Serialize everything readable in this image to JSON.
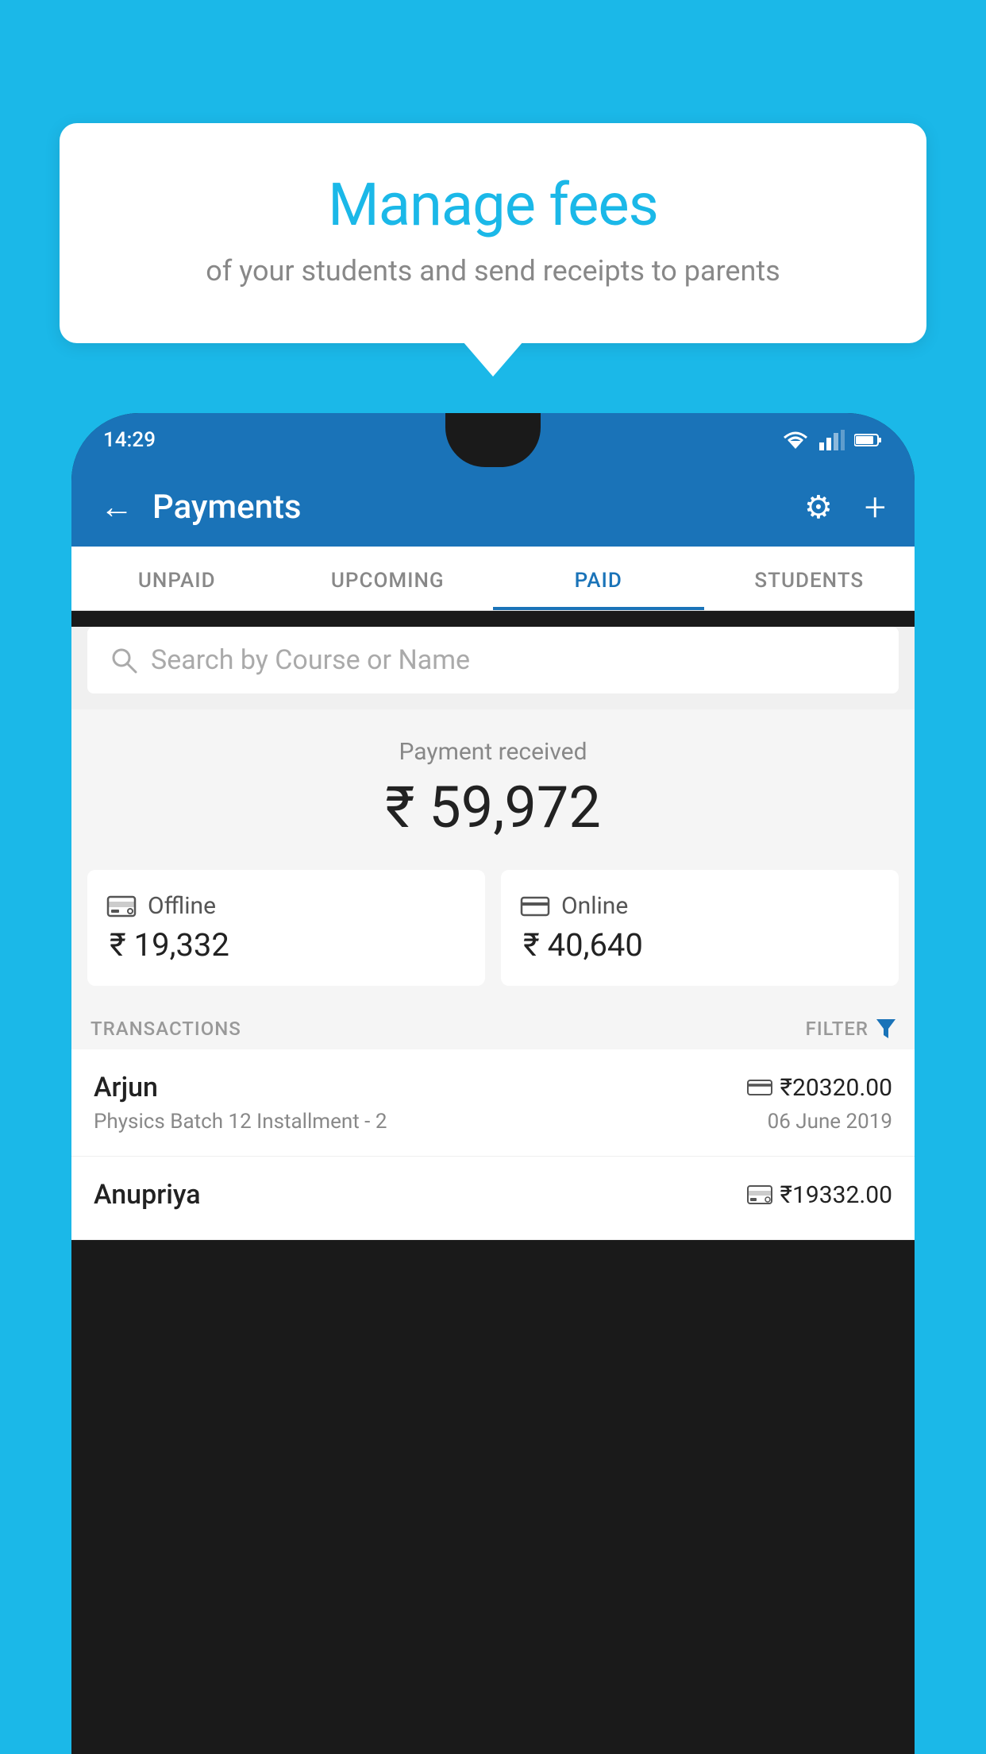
{
  "background_color": "#1BB8E8",
  "bubble": {
    "title": "Manage fees",
    "subtitle": "of your students and send receipts to parents"
  },
  "status_bar": {
    "time": "14:29",
    "signal_icon": "signal",
    "wifi_icon": "wifi",
    "battery_icon": "battery"
  },
  "header": {
    "title": "Payments",
    "back_label": "←",
    "gear_label": "⚙",
    "plus_label": "+"
  },
  "tabs": [
    {
      "id": "unpaid",
      "label": "UNPAID",
      "active": false
    },
    {
      "id": "upcoming",
      "label": "UPCOMING",
      "active": false
    },
    {
      "id": "paid",
      "label": "PAID",
      "active": true
    },
    {
      "id": "students",
      "label": "STUDENTS",
      "active": false
    }
  ],
  "search": {
    "placeholder": "Search by Course or Name"
  },
  "payment_received": {
    "label": "Payment received",
    "amount": "₹ 59,972"
  },
  "payment_cards": [
    {
      "id": "offline",
      "label": "Offline",
      "amount": "₹ 19,332",
      "icon": "offline-payment"
    },
    {
      "id": "online",
      "label": "Online",
      "amount": "₹ 40,640",
      "icon": "online-payment"
    }
  ],
  "transactions_label": "TRANSACTIONS",
  "filter_label": "FILTER",
  "transactions": [
    {
      "name": "Arjun",
      "course": "Physics Batch 12 Installment - 2",
      "amount": "₹20320.00",
      "date": "06 June 2019",
      "payment_type": "online"
    },
    {
      "name": "Anupriya",
      "course": "",
      "amount": "₹19332.00",
      "date": "",
      "payment_type": "offline"
    }
  ]
}
